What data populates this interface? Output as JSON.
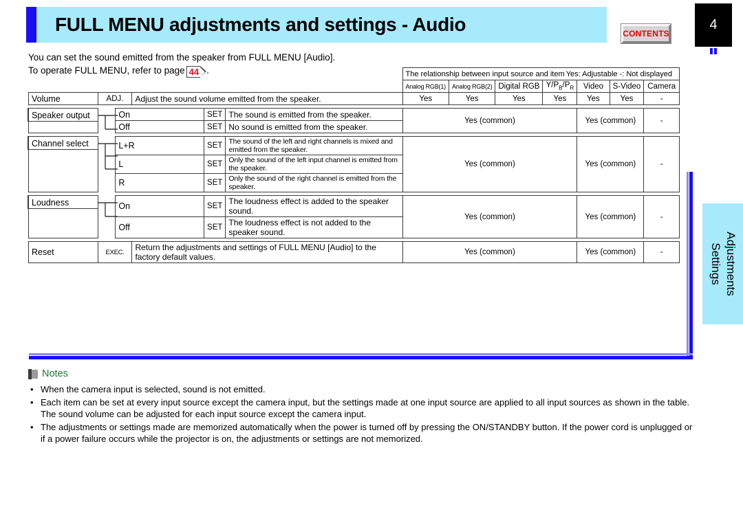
{
  "header": {
    "title": "FULL MENU adjustments and settings - Audio",
    "contents_button": "CONTENTS",
    "page_number": "4"
  },
  "intro": {
    "line1": "You can set the sound emitted from the speaker from FULL MENU [Audio].",
    "line2_prefix": "To operate FULL MENU, refer to page",
    "page_ref": "44",
    "line2_suffix": "."
  },
  "table": {
    "legend_left": "The relationship between input source and item",
    "legend_right": "Yes: Adjustable   -: Not displayed",
    "input_columns": [
      "Analog RGB(1)",
      "Analog RGB(2)",
      "Digital RGB",
      "Y/PB/PR",
      "Video",
      "S-Video",
      "Camera"
    ],
    "rows": {
      "volume": {
        "label": "Volume",
        "action": "ADJ.",
        "description": "Adjust the sound volume emitted from the speaker.",
        "values": [
          "Yes",
          "Yes",
          "Yes",
          "Yes",
          "Yes",
          "Yes",
          "-"
        ]
      },
      "speaker_output": {
        "label": "Speaker output",
        "options": [
          {
            "name": "On",
            "action": "SET",
            "description": "The sound is emitted from the speaker."
          },
          {
            "name": "Off",
            "action": "SET",
            "description": "No sound is emitted from the speaker."
          }
        ],
        "group_value_rgb": "Yes (common)",
        "group_value_video": "Yes (common)",
        "group_value_camera": "-"
      },
      "channel_select": {
        "label": "Channel select",
        "options": [
          {
            "name": "L+R",
            "action": "SET",
            "description": "The sound of the left and right channels is mixed and emitted from the speaker."
          },
          {
            "name": "L",
            "action": "SET",
            "description": "Only the sound of the left input channel is emitted from the speaker."
          },
          {
            "name": "R",
            "action": "SET",
            "description": "Only the sound of the right channel is emitted from the speaker."
          }
        ],
        "group_value_rgb": "Yes (common)",
        "group_value_video": "Yes (common)",
        "group_value_camera": "-"
      },
      "loudness": {
        "label": "Loudness",
        "options": [
          {
            "name": "On",
            "action": "SET",
            "description": "The loudness effect is added to the speaker sound."
          },
          {
            "name": "Off",
            "action": "SET",
            "description": "The loudness effect is not added to the speaker sound."
          }
        ],
        "group_value_rgb": "Yes (common)",
        "group_value_video": "Yes (common)",
        "group_value_camera": "-"
      },
      "reset": {
        "label": "Reset",
        "action": "EXEC.",
        "description": "Return the adjustments and settings of FULL MENU [Audio] to the factory default values.",
        "group_value_rgb": "Yes (common)",
        "group_value_video": "Yes (common)",
        "group_value_camera": "-"
      }
    }
  },
  "side_tab": {
    "line1": "Adjustments",
    "line2": "Settings"
  },
  "notes": {
    "title": "Notes",
    "bullet": "•",
    "items": [
      "When the camera input is selected, sound is not emitted.",
      "Each item can be set at every input source except the camera input, but the settings made at one input source are applied to all input sources as shown in the table. The sound volume can be adjusted for each input source except the camera input.",
      "The adjustments or settings made are memorized automatically when the power is turned off by pressing the ON/STANDBY button. If the power cord is unplugged or if a power failure occurs while the projector is on, the adjustments or settings are not memorized."
    ]
  },
  "colors": {
    "title_bg": "#a6eafb",
    "accent_blue": "#1a0ef5",
    "contents_red": "#ef0000",
    "notes_green": "#1a7a2e",
    "pageref_red": "#e01020"
  }
}
